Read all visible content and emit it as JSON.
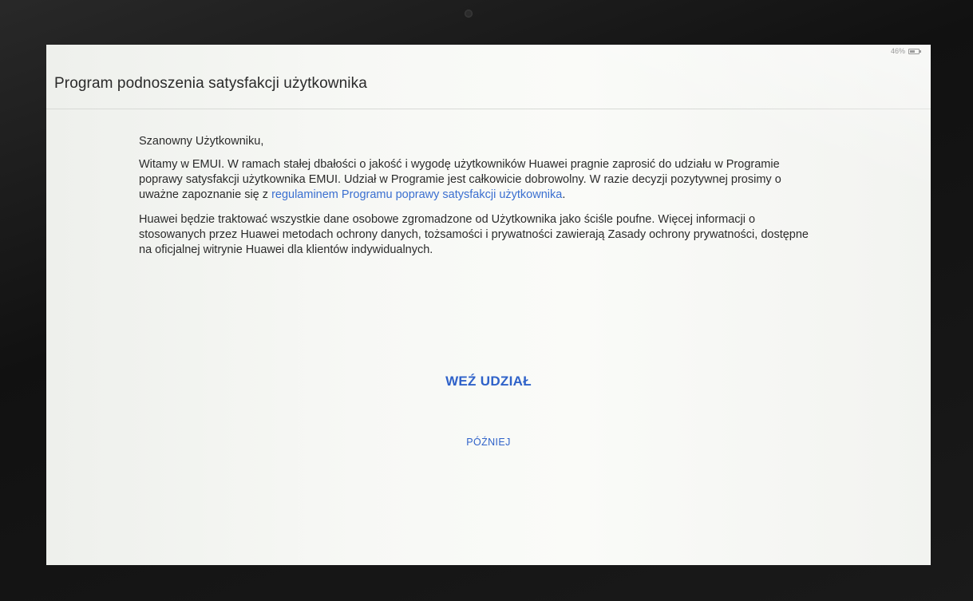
{
  "status_bar": {
    "battery_percent": "46%"
  },
  "header": {
    "title": "Program podnoszenia satysfakcji użytkownika"
  },
  "body": {
    "greeting": "Szanowny Użytkowniku,",
    "paragraph1_text": "Witamy w EMUI. W ramach stałej dbałości o jakość i wygodę użytkowników Huawei pragnie zaprosić do udziału w Programie poprawy satysfakcji użytkownika EMUI. Udział w Programie jest całkowicie dobrowolny. W razie decyzji pozytywnej prosimy o uważne zapoznanie się z ",
    "paragraph1_link": "regulaminem Programu poprawy satysfakcji użytkownika",
    "paragraph1_end": ".",
    "paragraph2": "Huawei będzie traktować wszystkie dane osobowe zgromadzone od Użytkownika jako ściśle poufne. Więcej informacji o stosowanych przez Huawei metodach ochrony danych, tożsamości i prywatności zawierają Zasady ochrony prywatności, dostępne na oficjalnej witrynie Huawei dla klientów indywidualnych."
  },
  "actions": {
    "join_label": "WEŹ UDZIAŁ",
    "later_label": "PÓŹNIEJ"
  },
  "colors": {
    "accent": "#2f62c9",
    "link": "#3a6fd0"
  }
}
